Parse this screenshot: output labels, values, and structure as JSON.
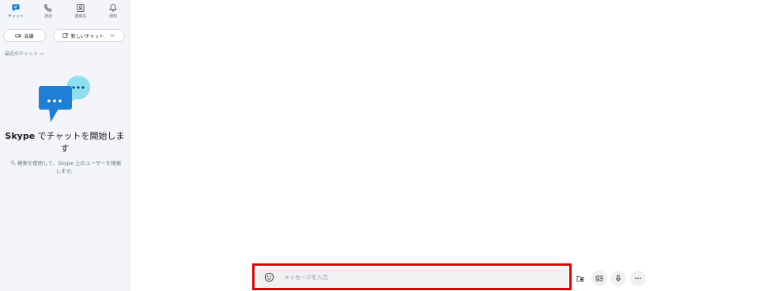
{
  "nav": {
    "chat": "チャット",
    "calls": "通話",
    "contacts": "連絡先",
    "notifications": "通知"
  },
  "actions": {
    "meet": "会議",
    "new_chat": "新しいチャット"
  },
  "recent": {
    "label": "最近のチャット"
  },
  "empty": {
    "title_brand": "Skype",
    "title_rest": " でチャットを開始します",
    "desc": "検索を使用して、Skype 上のユーザーを検索します。"
  },
  "composer": {
    "placeholder": "メッセージを入力"
  },
  "colors": {
    "accent": "#0078d4",
    "highlight": "#e00000"
  }
}
